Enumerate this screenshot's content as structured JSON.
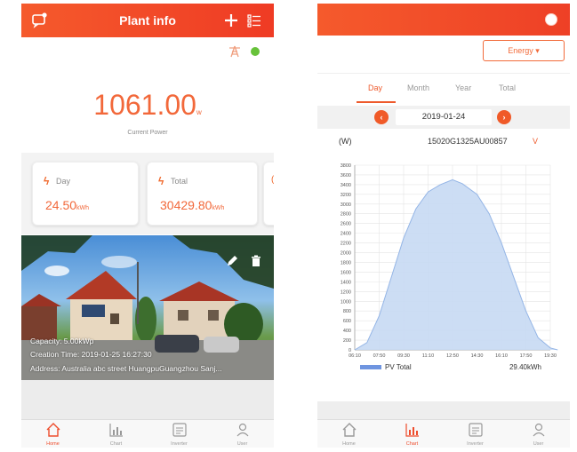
{
  "left_screen": {
    "header": {
      "title": "Plant info"
    },
    "icons": [
      "chat-bubble-icon",
      "plus-icon",
      "list-icon",
      "tower-icon",
      "online-dot"
    ],
    "current_power": {
      "value": "1061.00",
      "unit": "w",
      "label": "Current Power"
    },
    "cards": [
      {
        "label": "Day",
        "value": "24.50",
        "unit": "kWh"
      },
      {
        "label": "Total",
        "value": "30429.80",
        "unit": "kWh"
      }
    ],
    "photo": {
      "capacity": "Capacity: 5.00kWp",
      "creation_time": "Creation Time: 2019-01-25 16:27:30",
      "address": "Address: Australia abc street HuangpuGuangzhou Sanj..."
    },
    "tabbar": [
      {
        "label": "Home",
        "icon": "home-icon",
        "active": true
      },
      {
        "label": "Chart",
        "icon": "chart-icon",
        "active": false
      },
      {
        "label": "Inverter",
        "icon": "inverter-icon",
        "active": false
      },
      {
        "label": "User",
        "icon": "user-icon",
        "active": false
      }
    ]
  },
  "right_screen": {
    "energy_button": "Energy",
    "period_tabs": [
      {
        "label": "Day",
        "active": true
      },
      {
        "label": "Month",
        "active": false
      },
      {
        "label": "Year",
        "active": false
      },
      {
        "label": "Total",
        "active": false
      }
    ],
    "date": "2019-01-24",
    "unit_label": "(W)",
    "device_id": "15020G1325AU00857",
    "device_dropdown": "V",
    "legend": {
      "series": "PV Total",
      "total": "29.40kWh"
    },
    "tabbar": [
      {
        "label": "Home",
        "icon": "home-icon",
        "active": false
      },
      {
        "label": "Chart",
        "icon": "chart-icon",
        "active": true
      },
      {
        "label": "Inverter",
        "icon": "inverter-icon",
        "active": false
      },
      {
        "label": "User",
        "icon": "user-icon",
        "active": false
      }
    ]
  },
  "colors": {
    "accent": "#ef4a2a",
    "chart_fill": "#c6d9f3",
    "chart_line": "#94b5e6",
    "online": "#67c23a"
  },
  "chart_data": {
    "type": "area",
    "title": "",
    "xlabel": "",
    "ylabel": "(W)",
    "ylim": [
      0,
      3800
    ],
    "yticks": [
      0,
      200,
      400,
      600,
      800,
      1000,
      1200,
      1400,
      1600,
      1800,
      2000,
      2200,
      2400,
      2600,
      2800,
      3000,
      3200,
      3400,
      3600,
      3800
    ],
    "xticks": [
      "06:10",
      "07:50",
      "09:30",
      "11:10",
      "12:50",
      "14:30",
      "16:10",
      "17:50",
      "19:30"
    ],
    "series": [
      {
        "name": "PV Total",
        "x": [
          "06:10",
          "07:00",
          "07:50",
          "08:40",
          "09:30",
          "10:20",
          "11:10",
          "12:00",
          "12:50",
          "13:30",
          "14:30",
          "15:20",
          "16:10",
          "17:00",
          "17:50",
          "18:40",
          "19:30",
          "20:00"
        ],
        "values": [
          0,
          150,
          700,
          1500,
          2300,
          2900,
          3250,
          3400,
          3500,
          3420,
          3200,
          2800,
          2200,
          1500,
          800,
          250,
          40,
          0
        ]
      }
    ]
  }
}
